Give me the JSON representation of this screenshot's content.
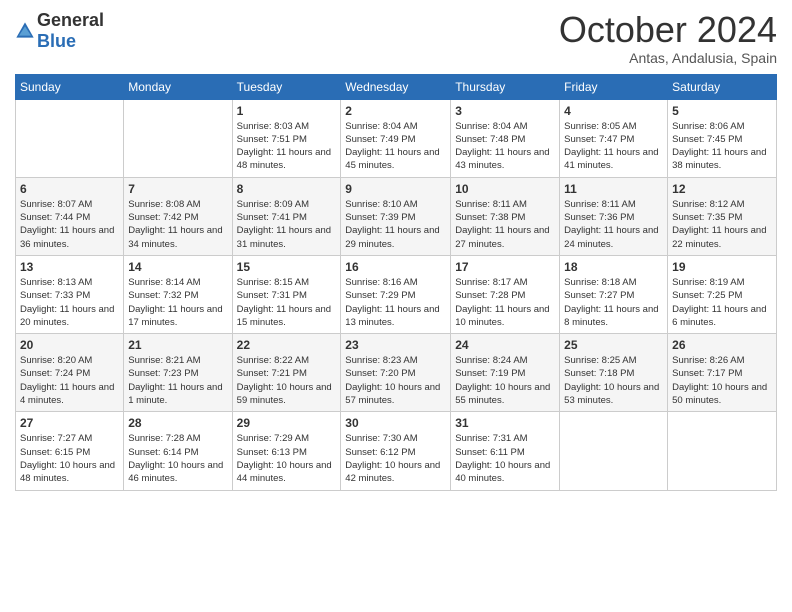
{
  "header": {
    "logo": {
      "text_general": "General",
      "text_blue": "Blue"
    },
    "title": "October 2024",
    "subtitle": "Antas, Andalusia, Spain"
  },
  "calendar": {
    "days_of_week": [
      "Sunday",
      "Monday",
      "Tuesday",
      "Wednesday",
      "Thursday",
      "Friday",
      "Saturday"
    ],
    "weeks": [
      {
        "days": [
          {
            "num": "",
            "info": ""
          },
          {
            "num": "",
            "info": ""
          },
          {
            "num": "1",
            "info": "Sunrise: 8:03 AM\nSunset: 7:51 PM\nDaylight: 11 hours and 48 minutes."
          },
          {
            "num": "2",
            "info": "Sunrise: 8:04 AM\nSunset: 7:49 PM\nDaylight: 11 hours and 45 minutes."
          },
          {
            "num": "3",
            "info": "Sunrise: 8:04 AM\nSunset: 7:48 PM\nDaylight: 11 hours and 43 minutes."
          },
          {
            "num": "4",
            "info": "Sunrise: 8:05 AM\nSunset: 7:47 PM\nDaylight: 11 hours and 41 minutes."
          },
          {
            "num": "5",
            "info": "Sunrise: 8:06 AM\nSunset: 7:45 PM\nDaylight: 11 hours and 38 minutes."
          }
        ]
      },
      {
        "days": [
          {
            "num": "6",
            "info": "Sunrise: 8:07 AM\nSunset: 7:44 PM\nDaylight: 11 hours and 36 minutes."
          },
          {
            "num": "7",
            "info": "Sunrise: 8:08 AM\nSunset: 7:42 PM\nDaylight: 11 hours and 34 minutes."
          },
          {
            "num": "8",
            "info": "Sunrise: 8:09 AM\nSunset: 7:41 PM\nDaylight: 11 hours and 31 minutes."
          },
          {
            "num": "9",
            "info": "Sunrise: 8:10 AM\nSunset: 7:39 PM\nDaylight: 11 hours and 29 minutes."
          },
          {
            "num": "10",
            "info": "Sunrise: 8:11 AM\nSunset: 7:38 PM\nDaylight: 11 hours and 27 minutes."
          },
          {
            "num": "11",
            "info": "Sunrise: 8:11 AM\nSunset: 7:36 PM\nDaylight: 11 hours and 24 minutes."
          },
          {
            "num": "12",
            "info": "Sunrise: 8:12 AM\nSunset: 7:35 PM\nDaylight: 11 hours and 22 minutes."
          }
        ]
      },
      {
        "days": [
          {
            "num": "13",
            "info": "Sunrise: 8:13 AM\nSunset: 7:33 PM\nDaylight: 11 hours and 20 minutes."
          },
          {
            "num": "14",
            "info": "Sunrise: 8:14 AM\nSunset: 7:32 PM\nDaylight: 11 hours and 17 minutes."
          },
          {
            "num": "15",
            "info": "Sunrise: 8:15 AM\nSunset: 7:31 PM\nDaylight: 11 hours and 15 minutes."
          },
          {
            "num": "16",
            "info": "Sunrise: 8:16 AM\nSunset: 7:29 PM\nDaylight: 11 hours and 13 minutes."
          },
          {
            "num": "17",
            "info": "Sunrise: 8:17 AM\nSunset: 7:28 PM\nDaylight: 11 hours and 10 minutes."
          },
          {
            "num": "18",
            "info": "Sunrise: 8:18 AM\nSunset: 7:27 PM\nDaylight: 11 hours and 8 minutes."
          },
          {
            "num": "19",
            "info": "Sunrise: 8:19 AM\nSunset: 7:25 PM\nDaylight: 11 hours and 6 minutes."
          }
        ]
      },
      {
        "days": [
          {
            "num": "20",
            "info": "Sunrise: 8:20 AM\nSunset: 7:24 PM\nDaylight: 11 hours and 4 minutes."
          },
          {
            "num": "21",
            "info": "Sunrise: 8:21 AM\nSunset: 7:23 PM\nDaylight: 11 hours and 1 minute."
          },
          {
            "num": "22",
            "info": "Sunrise: 8:22 AM\nSunset: 7:21 PM\nDaylight: 10 hours and 59 minutes."
          },
          {
            "num": "23",
            "info": "Sunrise: 8:23 AM\nSunset: 7:20 PM\nDaylight: 10 hours and 57 minutes."
          },
          {
            "num": "24",
            "info": "Sunrise: 8:24 AM\nSunset: 7:19 PM\nDaylight: 10 hours and 55 minutes."
          },
          {
            "num": "25",
            "info": "Sunrise: 8:25 AM\nSunset: 7:18 PM\nDaylight: 10 hours and 53 minutes."
          },
          {
            "num": "26",
            "info": "Sunrise: 8:26 AM\nSunset: 7:17 PM\nDaylight: 10 hours and 50 minutes."
          }
        ]
      },
      {
        "days": [
          {
            "num": "27",
            "info": "Sunrise: 7:27 AM\nSunset: 6:15 PM\nDaylight: 10 hours and 48 minutes."
          },
          {
            "num": "28",
            "info": "Sunrise: 7:28 AM\nSunset: 6:14 PM\nDaylight: 10 hours and 46 minutes."
          },
          {
            "num": "29",
            "info": "Sunrise: 7:29 AM\nSunset: 6:13 PM\nDaylight: 10 hours and 44 minutes."
          },
          {
            "num": "30",
            "info": "Sunrise: 7:30 AM\nSunset: 6:12 PM\nDaylight: 10 hours and 42 minutes."
          },
          {
            "num": "31",
            "info": "Sunrise: 7:31 AM\nSunset: 6:11 PM\nDaylight: 10 hours and 40 minutes."
          },
          {
            "num": "",
            "info": ""
          },
          {
            "num": "",
            "info": ""
          }
        ]
      }
    ]
  }
}
